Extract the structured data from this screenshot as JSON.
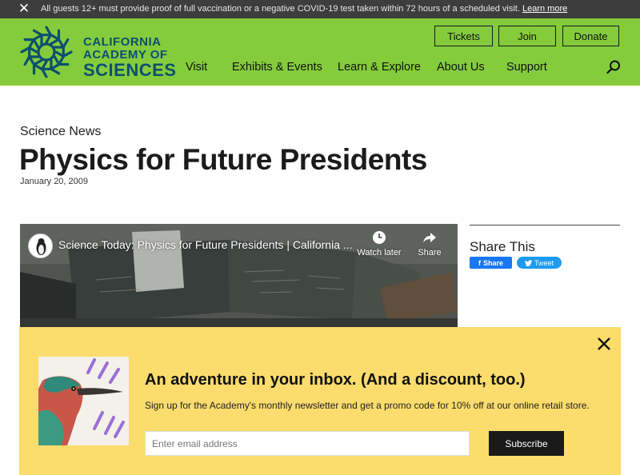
{
  "alert": {
    "close_glyph": "✕",
    "message": "All guests 12+ must provide proof of full vaccination or a negative COVID-19 test taken within 72 hours of a scheduled visit.",
    "link_label": "Learn more"
  },
  "header": {
    "logo": {
      "line1": "CALIFORNIA",
      "line2": "ACADEMY OF",
      "line3": "SCIENCES",
      "color": "#0d4f6e"
    },
    "bg_color": "#84cc3c",
    "utility_buttons": {
      "tickets": "Tickets",
      "join": "Join",
      "donate": "Donate"
    },
    "nav": [
      "Visit",
      "Exhibits & Events",
      "Learn & Explore",
      "About Us",
      "Support"
    ],
    "search_icon": "search-icon"
  },
  "article": {
    "eyebrow": "Science News",
    "title": "Physics for Future Presidents",
    "date": "January 20, 2009"
  },
  "video": {
    "title": "Science Today: Physics for Future Presidents | California ...",
    "watch_later_label": "Watch later",
    "share_label": "Share"
  },
  "share": {
    "title": "Share This",
    "facebook_label": "Share",
    "twitter_label": "Tweet",
    "facebook_color": "#1877f2",
    "twitter_color": "#1d9bf0"
  },
  "newsletter": {
    "bg_color": "#fbdc6c",
    "heading": "An adventure in your inbox. (And a discount, too.)",
    "subtext": "Sign up for the Academy's monthly newsletter and get a promo code for 10% off at our online retail store.",
    "email_placeholder": "Enter email address",
    "subscribe_label": "Subscribe"
  }
}
